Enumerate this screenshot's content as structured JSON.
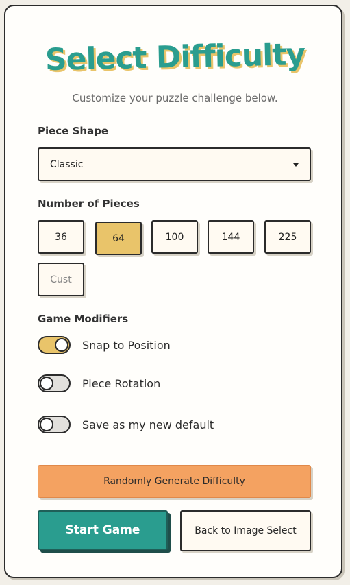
{
  "title": "Select Difficulty",
  "subtitle": "Customize your puzzle challenge below.",
  "piece_shape": {
    "label": "Piece Shape",
    "selected": "Classic"
  },
  "pieces": {
    "label": "Number of Pieces",
    "options": [
      "36",
      "64",
      "100",
      "144",
      "225",
      "Cust"
    ],
    "selected": "64"
  },
  "modifiers": {
    "label": "Game Modifiers",
    "toggles": [
      {
        "label": "Snap to Position",
        "on": true
      },
      {
        "label": "Piece Rotation",
        "on": false
      },
      {
        "label": "Save as my new default",
        "on": false
      }
    ]
  },
  "actions": {
    "random": "Randomly Generate Difficulty",
    "start": "Start Game",
    "back": "Back to Image Select"
  },
  "colors": {
    "accent_teal": "#2a9d8f",
    "accent_yellow": "#e9c46a",
    "accent_orange": "#f4a261"
  }
}
